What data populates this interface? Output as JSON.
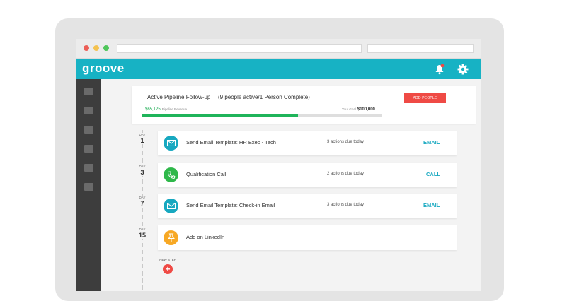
{
  "app": {
    "logo": "groove",
    "colors": {
      "accent": "#17b2c4",
      "sidebar": "#3d3d3d",
      "danger": "#ef4a45",
      "success": "#1fb45a"
    },
    "icons": {
      "notifications": "bell-icon",
      "settings": "gear-icon"
    }
  },
  "summary": {
    "title": "Active Pipeline Follow-up",
    "status": "(9 people active/1 Person Complete)",
    "add_people": "ADD PEOPLE",
    "revenue_value": "$65,125",
    "revenue_label": "Pipeline Revenue",
    "goal_label": "Your Goal",
    "goal_value": "$100,000",
    "progress_fraction": 0.65
  },
  "steps": [
    {
      "day_label": "DAY",
      "day": "1",
      "icon": "email-icon",
      "name": "Send Email Template: HR Exec - Tech",
      "due": "3 actions due today",
      "action": "EMAIL"
    },
    {
      "day_label": "DAY",
      "day": "3",
      "icon": "phone-icon",
      "name": "Qualification Call",
      "due": "2 actions due today",
      "action": "CALL"
    },
    {
      "day_label": "DAY",
      "day": "7",
      "icon": "email-icon",
      "name": "Send Email Template: Check-in Email",
      "due": "3 actions due today",
      "action": "EMAIL"
    },
    {
      "day_label": "DAY",
      "day": "15",
      "icon": "linkedin-pin-icon",
      "name": "Add on LinkedIn",
      "due": "",
      "action": ""
    }
  ],
  "new_step": {
    "label": "NEW STEP",
    "plus": "+"
  }
}
